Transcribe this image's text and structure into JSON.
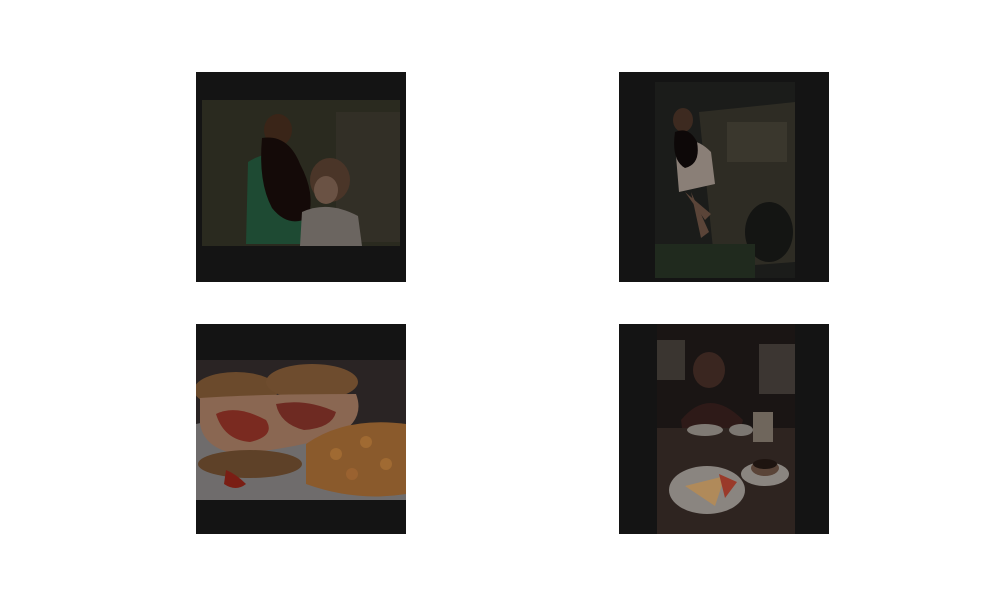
{
  "tiles": [
    {
      "subject": "two-people-indoor-photo"
    },
    {
      "subject": "person-standing-by-vehicle-photo"
    },
    {
      "subject": "sandwich-with-side-dish-photo"
    },
    {
      "subject": "person-at-cafe-table-with-cake-and-coffee-photo"
    }
  ]
}
